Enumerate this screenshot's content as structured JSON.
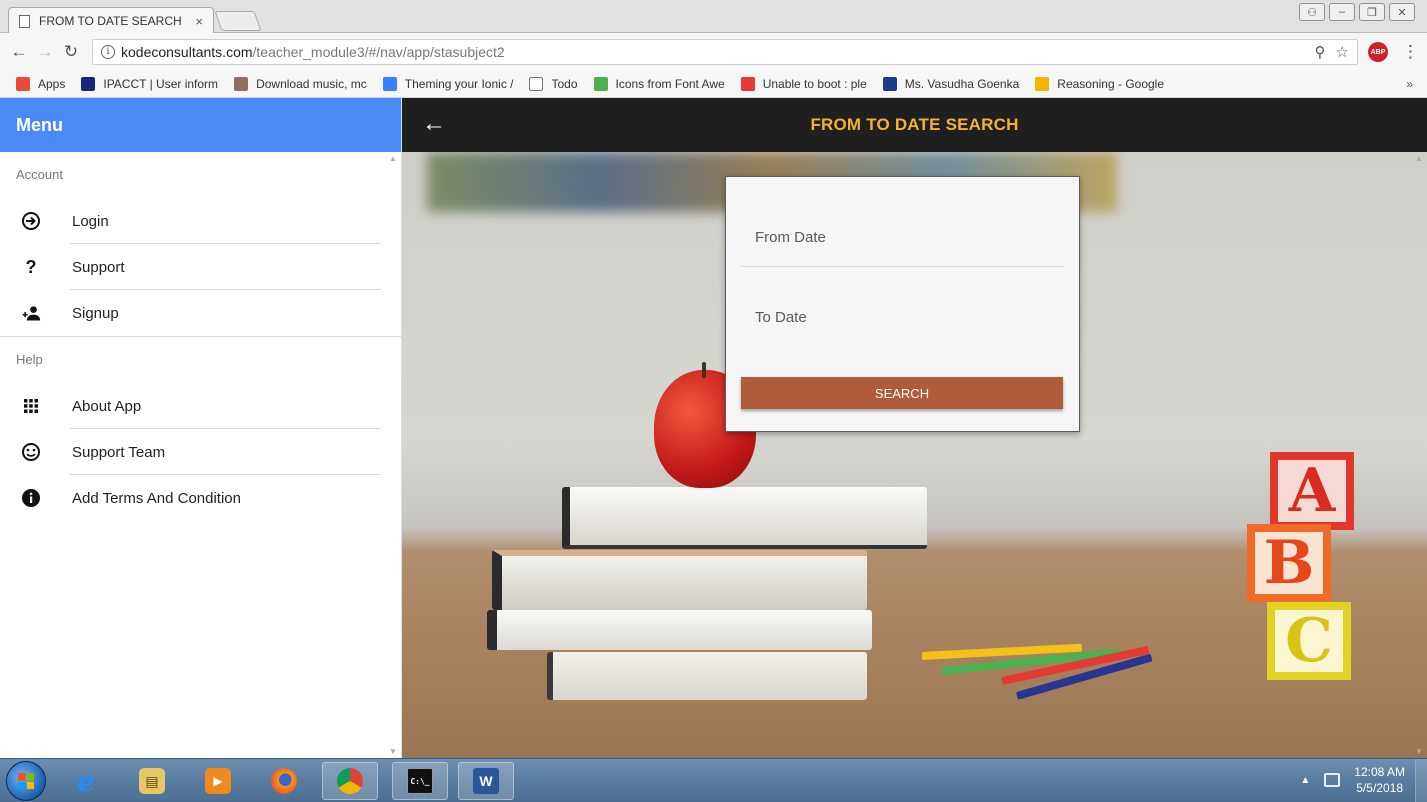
{
  "browser": {
    "tab_title": "FROM TO DATE SEARCH",
    "tab_close": "×",
    "url_host": "kodeconsultants.com",
    "url_path": "/teacher_module3/#/nav/app/stasubject2",
    "abp_label": "ABP",
    "bookmarks": [
      {
        "label": "Apps",
        "icon": "apps-grid-icon",
        "color": "#e74c3c"
      },
      {
        "label": "IPACCT | User inform",
        "icon": "ipacct-icon",
        "color": "#1a237e"
      },
      {
        "label": "Download music, mc",
        "icon": "music-icon",
        "color": "#8d6e63"
      },
      {
        "label": "Theming your Ionic /",
        "icon": "ionic-icon",
        "color": "#3880ff"
      },
      {
        "label": "Todo",
        "icon": "page-icon",
        "color": "#ffffff"
      },
      {
        "label": "Icons from Font Awe",
        "icon": "w3-icon",
        "color": "#4caf50"
      },
      {
        "label": "Unable to boot : ple",
        "icon": "youtube-icon",
        "color": "#e53935"
      },
      {
        "label": "Ms. Vasudha Goenka",
        "icon": "p-icon",
        "color": "#1e3a8a"
      },
      {
        "label": "Reasoning - Google",
        "icon": "drive-icon",
        "color": "#f4b400"
      }
    ],
    "bookmarks_more": "»"
  },
  "menu": {
    "title": "Menu",
    "sections": [
      {
        "heading": "Account",
        "items": [
          {
            "label": "Login",
            "icon": "login-icon",
            "glyph": "⇥"
          },
          {
            "label": "Support",
            "icon": "question-icon",
            "glyph": "?"
          },
          {
            "label": "Signup",
            "icon": "person-add-icon",
            "glyph": "+"
          }
        ]
      },
      {
        "heading": "Help",
        "items": [
          {
            "label": "About App",
            "icon": "apps-icon",
            "glyph": "⠿"
          },
          {
            "label": "Support Team",
            "icon": "smiley-icon",
            "glyph": "☺"
          },
          {
            "label": "Add Terms And Condition",
            "icon": "info-icon",
            "glyph": "i"
          }
        ]
      }
    ]
  },
  "header": {
    "back_glyph": "←",
    "title": "FROM TO DATE SEARCH",
    "title_color": "#f2b233"
  },
  "form": {
    "from_label": "From Date",
    "to_label": "To Date",
    "search_label": "SEARCH",
    "button_color": "#b05c3a"
  },
  "taskbar": {
    "time": "12:08 AM",
    "date": "5/5/2018",
    "apps": [
      {
        "name": "internet-explorer-icon",
        "glyph": "e"
      },
      {
        "name": "file-explorer-icon",
        "glyph": "▤"
      },
      {
        "name": "media-player-icon",
        "glyph": "▶"
      },
      {
        "name": "firefox-icon",
        "glyph": ""
      },
      {
        "name": "chrome-icon",
        "glyph": ""
      },
      {
        "name": "cmd-icon",
        "glyph": "C:\\_"
      },
      {
        "name": "word-icon",
        "glyph": "W"
      }
    ]
  },
  "colors": {
    "menu_header": "#4a8af4",
    "toolbar": "#1f1f1f"
  }
}
